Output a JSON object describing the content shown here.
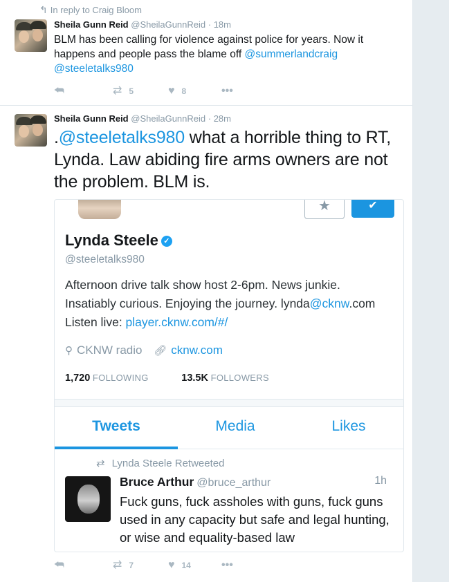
{
  "tweet1": {
    "reply_context": "In reply to Craig Bloom",
    "name": "Sheila Gunn Reid",
    "handle": "@SheilaGunnReid",
    "time": "· 18m",
    "text_prefix": "BLM has been calling for violence against police for years. Now it happens and people pass the blame off ",
    "mention1": "@summerlandcraig",
    "mention2": "@steeletalks980",
    "retweets": "5",
    "likes": "8"
  },
  "tweet2": {
    "name": "Sheila Gunn Reid",
    "handle": "@SheilaGunnReid",
    "time": "· 28m",
    "text_lead": ".",
    "mention": "@steeletalks980",
    "text_rest": " what a horrible thing to RT, Lynda. Law abiding fire arms owners are not the problem. BLM is.",
    "retweets": "7",
    "likes": "14"
  },
  "profile_card": {
    "name": "Lynda Steele",
    "verified_glyph": "✓",
    "handle": "@steeletalks980",
    "bio_line1": "Afternoon drive talk show host 2-6pm.  News junkie. Insatiably curious. Enjoying the journey. lynda",
    "bio_mention": "@cknw",
    "bio_line2": ".com Listen live: ",
    "bio_link": "player.cknw.com/#/",
    "location": "CKNW radio",
    "website": "cknw.com",
    "following_count": "1,720",
    "following_label": "FOLLOWING",
    "followers_count": "13.5K",
    "followers_label": "FOLLOWERS",
    "tabs": [
      "Tweets",
      "Media",
      "Likes"
    ],
    "retweeted_by": "Lynda Steele Retweeted",
    "inner_tweet": {
      "name": "Bruce Arthur",
      "handle": "@bruce_arthur",
      "time": "1h",
      "text": "Fuck guns, fuck assholes with guns, fuck guns used in any capacity but safe and legal hunting, or wise and equality-based law"
    }
  },
  "icons": {
    "reply": "reply-icon",
    "retweet": "retweet-icon",
    "like": "heart-icon",
    "more": "more-icon",
    "location": "location-pin-icon",
    "link": "link-icon"
  },
  "colors": {
    "accent": "#1b95e0",
    "muted": "#8899a6",
    "icon_gray": "#aab8c2"
  }
}
